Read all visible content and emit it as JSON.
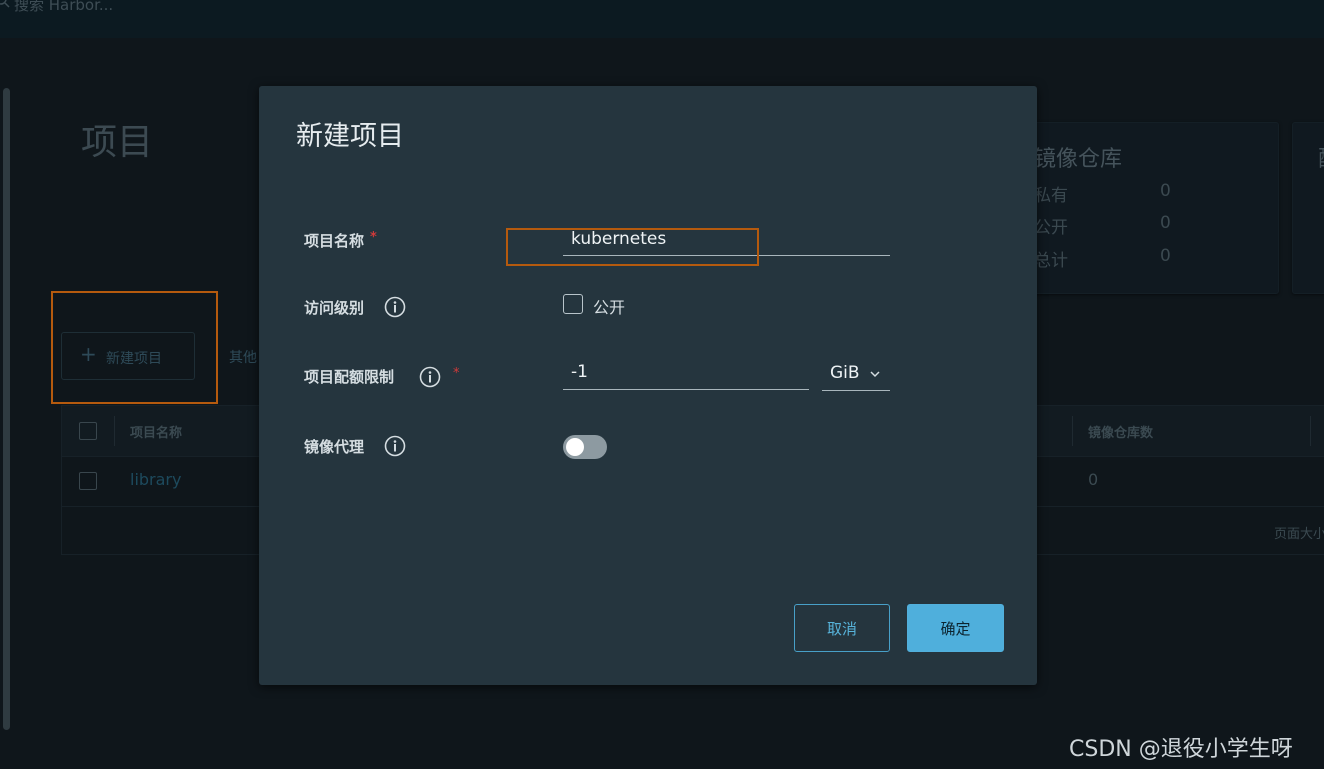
{
  "header": {
    "search_placeholder": "搜索 Harbor..."
  },
  "page": {
    "title": "项目"
  },
  "summary_card": {
    "title": "镜像仓库",
    "rows": [
      {
        "label": "私有",
        "value": "0"
      },
      {
        "label": "公开",
        "value": "0"
      },
      {
        "label": "总计",
        "value": "0"
      }
    ],
    "second_card_title": "配"
  },
  "toolbar": {
    "new_project_label": "新建项目",
    "other_label": "其他"
  },
  "table": {
    "headers": {
      "name": "项目名称",
      "repo_count": "镜像仓库数"
    },
    "rows": [
      {
        "name": "library",
        "repo_count": "0"
      }
    ],
    "footer_text": "页面大小"
  },
  "modal": {
    "title": "新建项目",
    "fields": {
      "project_name": {
        "label": "项目名称",
        "required_mark": "*",
        "value": "kubernetes"
      },
      "access_level": {
        "label": "访问级别",
        "checkbox_label": "公开",
        "checked": false
      },
      "quota": {
        "label": "项目配额限制",
        "required_mark": "*",
        "value": "-1",
        "unit": "GiB"
      },
      "proxy_cache": {
        "label": "镜像代理",
        "enabled": false
      }
    },
    "cancel_label": "取消",
    "ok_label": "确定"
  },
  "watermark": "CSDN @退役小学生呀",
  "icons": {
    "search": "search-icon",
    "info": "info-icon",
    "plus": "plus-icon",
    "chevron": "chevron-down-icon"
  },
  "colors": {
    "modal_bg": "#25353e",
    "primary": "#4fafdc",
    "highlight_box": "#b55a0e",
    "required": "#d13a3a"
  }
}
